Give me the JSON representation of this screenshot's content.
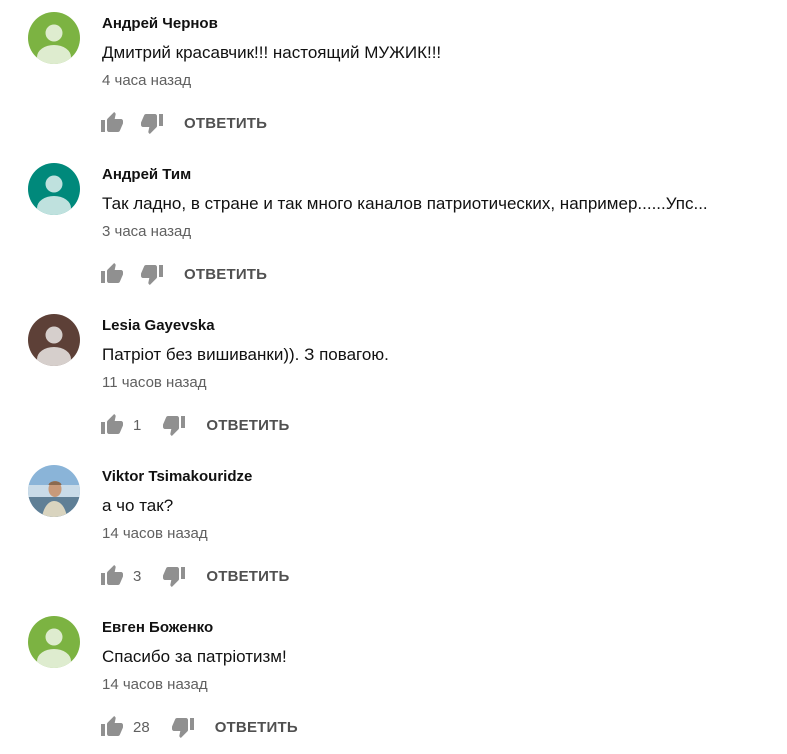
{
  "comments": [
    {
      "author": "Андрей Чернов",
      "text": "Дмитрий красавчик!!! настоящий МУЖИК!!!",
      "time": "4 часа назад",
      "likes": "",
      "reply_label": "ОТВЕТИТЬ",
      "avatar": {
        "type": "default",
        "color": "#7cb342"
      }
    },
    {
      "author": "Андрей Тим",
      "text": "Так ладно, в стране и так много каналов патриотических, например......Упс...",
      "time": "3 часа назад",
      "likes": "",
      "reply_label": "ОТВЕТИТЬ",
      "avatar": {
        "type": "default",
        "color": "#00897b"
      }
    },
    {
      "author": "Lesia Gayevska",
      "text": "Патріот без вишиванки)). З повагою.",
      "time": "11 часов назад",
      "likes": "1",
      "reply_label": "ОТВЕТИТЬ",
      "avatar": {
        "type": "default",
        "color": "#5d4037"
      }
    },
    {
      "author": "Viktor Tsimakouridze",
      "text": "а чо так?",
      "time": "14 часов назад",
      "likes": "3",
      "reply_label": "ОТВЕТИТЬ",
      "avatar": {
        "type": "photo",
        "color": "#8ab4d8"
      }
    },
    {
      "author": "Евген Боженко",
      "text": "Спасибо  за патріотизм!",
      "time": "14 часов назад",
      "likes": "28",
      "reply_label": "ОТВЕТИТЬ",
      "avatar": {
        "type": "default",
        "color": "#7cb342"
      }
    }
  ],
  "icons": {
    "like": "thumb-up-icon",
    "dislike": "thumb-down-icon"
  },
  "colors": {
    "text": "#111111",
    "secondary": "#606060",
    "icon": "#909090"
  }
}
